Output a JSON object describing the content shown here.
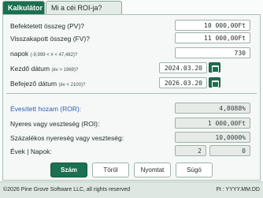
{
  "tabs": {
    "calc": "Kalkulátor",
    "about": "Mi a céi ROI-ja?"
  },
  "fields": {
    "pv": {
      "label": "Befektetett összeg (PV)?",
      "value": "10 000,00Ft"
    },
    "fv": {
      "label": "Visszakapott összeg (FV)?",
      "value": "11 000,00Ft"
    },
    "days": {
      "label": "napok",
      "hint": "(-9,999 < # < 47,482)?",
      "value": "730"
    },
    "start": {
      "label": "Kezdő dátum",
      "hint": "(év > 1969)?",
      "value": "2024.03.20"
    },
    "end": {
      "label": "Befejező dátum",
      "hint": "(év < 2100)?",
      "value": "2026.03.20"
    }
  },
  "results": {
    "ror": {
      "label": "Évesített hozam (ROR):",
      "value": "4,8088%"
    },
    "gain": {
      "label": "Nyeres vagy veszteség (ROI):",
      "value": "1 000,00Ft"
    },
    "pct": {
      "label": "Százalékos nyereség vagy veszteség:",
      "value": "10,0000%"
    },
    "years": {
      "label": "Évek | Napok:",
      "y": "2",
      "d": "0"
    }
  },
  "buttons": {
    "calc": "Szám",
    "clear": "Töröl",
    "print": "Nyomtat",
    "help": "Súgó"
  },
  "footer": {
    "copyright": "©2026 Pine Grove Software LLC, all rights reserved",
    "format": "Ft : YYYY.MM.DD"
  },
  "colors": {
    "accent": "#1a7050",
    "ror_label": "#2f5bb7"
  },
  "icons": {
    "calendar": "calendar-icon"
  }
}
